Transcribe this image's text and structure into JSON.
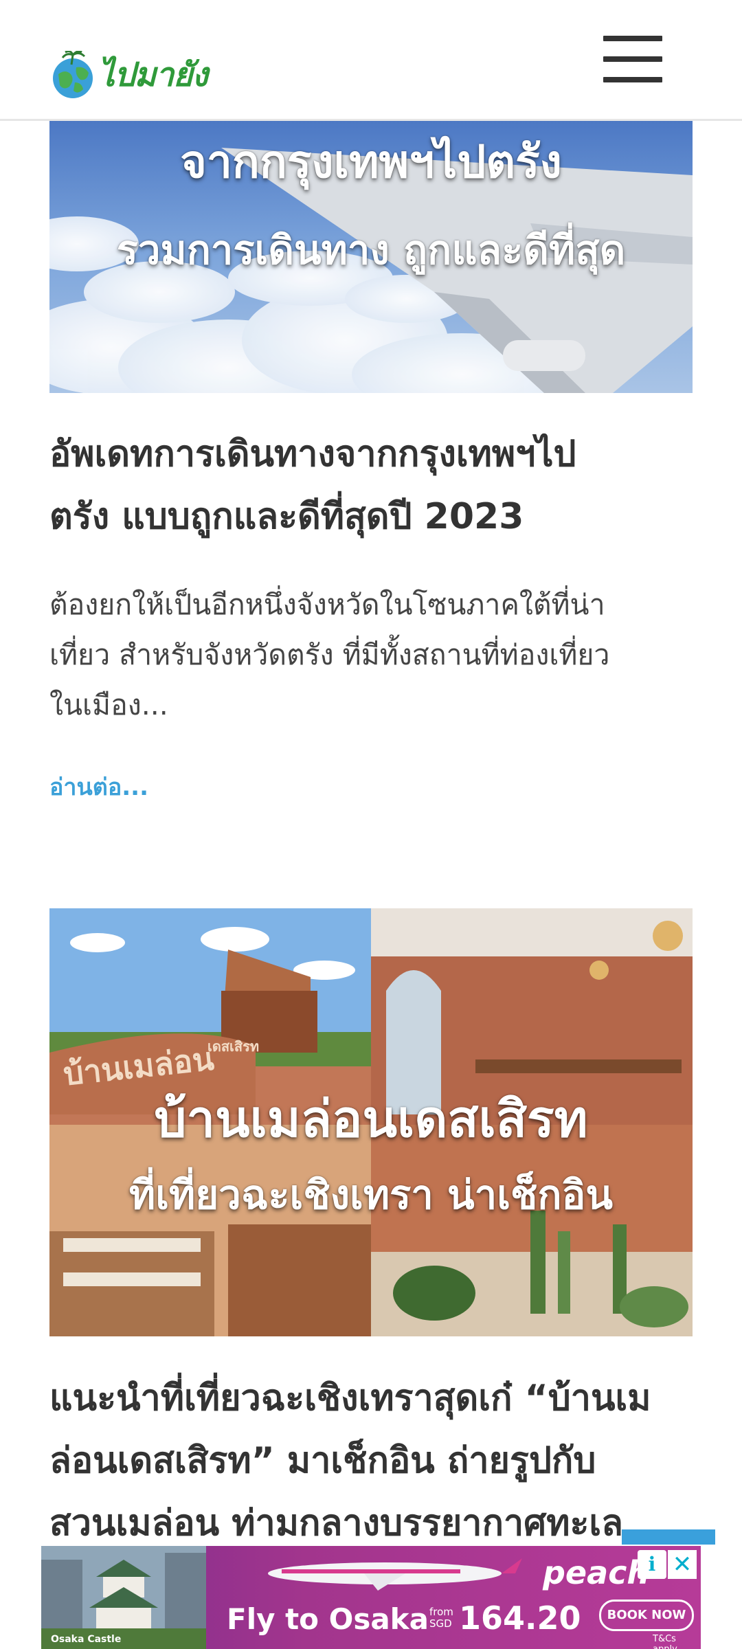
{
  "header": {
    "logo_text": "ไปมายัง",
    "menu_icon": "hamburger-menu-icon"
  },
  "articles": [
    {
      "image": {
        "overlay_line1": "จากกรุงเทพฯไปตรัง",
        "overlay_line2": "รวมการเดินทาง ถูกและดีที่สุด"
      },
      "title_lines": [
        "อัพเดทการเดินทางจากกรุงเทพฯไป",
        "ตรัง แบบถูกและดีที่สุดปี 2023"
      ],
      "excerpt_lines": [
        "ต้องยกให้เป็นอีกหนึ่งจังหวัดในโซนภาคใต้ที่น่า",
        "เที่ยว สำหรับจังหวัดตรัง ที่มีทั้งสถานที่ท่องเที่ยว",
        "ในเมือง..."
      ],
      "read_more": "อ่านต่อ..."
    },
    {
      "image": {
        "overlay_line1": "บ้านเมล่อนเดสเสิรท",
        "overlay_line2": "ที่เที่ยวฉะเชิงเทรา น่าเช็กอิน",
        "sign_text": "บ้านเมล่อน",
        "sign_small": "เดสเสิรท",
        "roof_sign": "บ้านเมล่อน"
      },
      "title_lines": [
        "แนะนำที่เที่ยวฉะเชิงเทราสุดเก๋ “บ้านเม",
        "ล่อนเดสเสิรท” มาเช็กอิน ถ่ายรูปกับ",
        "สวนเมล่อน ท่ามกลางบรรยากาศทะเล"
      ]
    }
  ],
  "ad": {
    "brand": "peach",
    "headline": "Fly to Osaka",
    "from_label_1": "from",
    "from_label_2": "SGD",
    "price": "164.20",
    "cta": "BOOK NOW",
    "terms": "T&Cs apply.",
    "photo_caption": "Osaka Castle",
    "info_icon": "i",
    "close_icon": "✕"
  }
}
